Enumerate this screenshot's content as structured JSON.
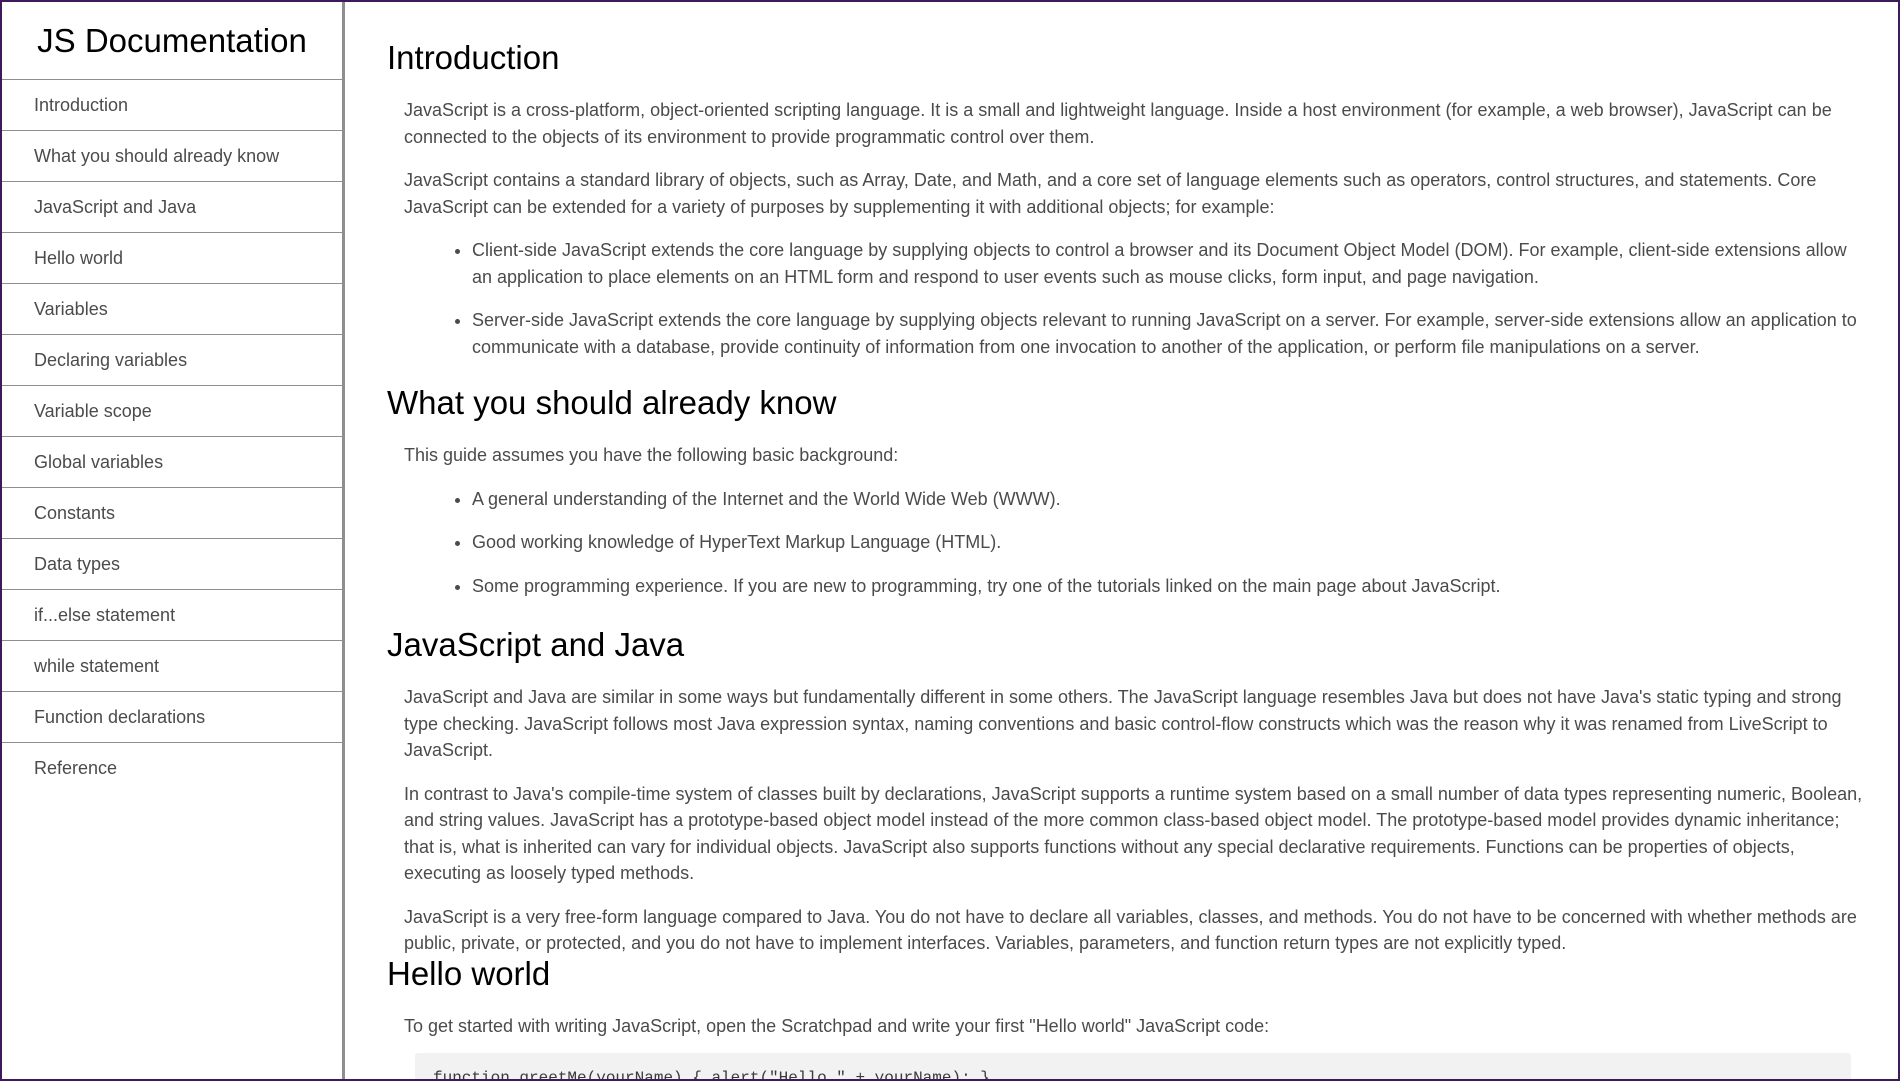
{
  "navbar": {
    "title": "JS Documentation",
    "items": [
      "Introduction",
      "What you should already know",
      "JavaScript and Java",
      "Hello world",
      "Variables",
      "Declaring variables",
      "Variable scope",
      "Global variables",
      "Constants",
      "Data types",
      "if...else statement",
      "while statement",
      "Function declarations",
      "Reference"
    ]
  },
  "sections": {
    "introduction": {
      "heading": "Introduction",
      "p1": "JavaScript is a cross-platform, object-oriented scripting language. It is a small and lightweight language. Inside a host environment (for example, a web browser), JavaScript can be connected to the objects of its environment to provide programmatic control over them.",
      "p2": "JavaScript contains a standard library of objects, such as Array, Date, and Math, and a core set of language elements such as operators, control structures, and statements. Core JavaScript can be extended for a variety of purposes by supplementing it with additional objects; for example:",
      "bullets": [
        "Client-side JavaScript extends the core language by supplying objects to control a browser and its Document Object Model (DOM). For example, client-side extensions allow an application to place elements on an HTML form and respond to user events such as mouse clicks, form input, and page navigation.",
        "Server-side JavaScript extends the core language by supplying objects relevant to running JavaScript on a server. For example, server-side extensions allow an application to communicate with a database, provide continuity of information from one invocation to another of the application, or perform file manipulations on a server."
      ]
    },
    "already_know": {
      "heading": "What you should already know",
      "p1": "This guide assumes you have the following basic background:",
      "bullets": [
        "A general understanding of the Internet and the World Wide Web (WWW).",
        "Good working knowledge of HyperText Markup Language (HTML).",
        "Some programming experience. If you are new to programming, try one of the tutorials linked on the main page about JavaScript."
      ]
    },
    "js_and_java": {
      "heading": "JavaScript and Java",
      "p1": "JavaScript and Java are similar in some ways but fundamentally different in some others. The JavaScript language resembles Java but does not have Java's static typing and strong type checking. JavaScript follows most Java expression syntax, naming conventions and basic control-flow constructs which was the reason why it was renamed from LiveScript to JavaScript.",
      "p2": "In contrast to Java's compile-time system of classes built by declarations, JavaScript supports a runtime system based on a small number of data types representing numeric, Boolean, and string values. JavaScript has a prototype-based object model instead of the more common class-based object model. The prototype-based model provides dynamic inheritance; that is, what is inherited can vary for individual objects. JavaScript also supports functions without any special declarative requirements. Functions can be properties of objects, executing as loosely typed methods.",
      "p3": "JavaScript is a very free-form language compared to Java. You do not have to declare all variables, classes, and methods. You do not have to be concerned with whether methods are public, private, or protected, and you do not have to implement interfaces. Variables, parameters, and function return types are not explicitly typed."
    },
    "hello_world": {
      "heading": "Hello world",
      "p1": "To get started with writing JavaScript, open the Scratchpad and write your first \"Hello world\" JavaScript code:",
      "code": "function greetMe(yourName) { alert(\"Hello \" + yourName); }"
    }
  }
}
